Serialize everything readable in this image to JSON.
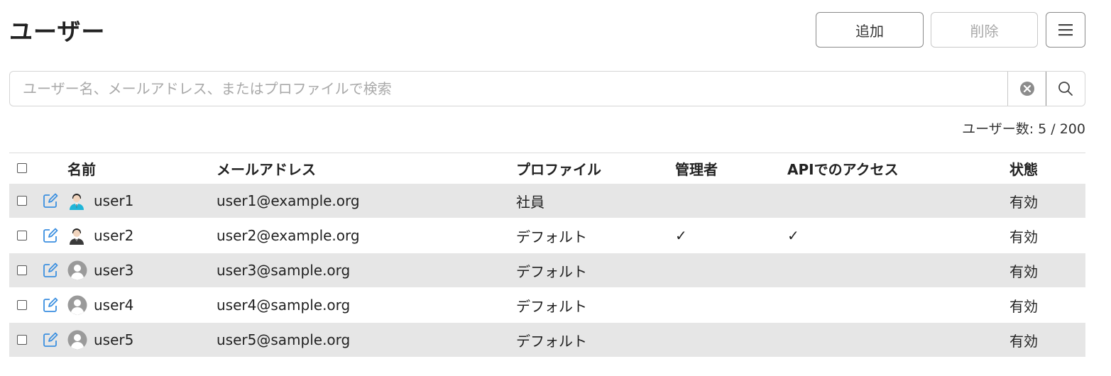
{
  "page": {
    "title": "ユーザー"
  },
  "toolbar": {
    "add_label": "追加",
    "delete_label": "削除",
    "menu_icon": "hamburger-menu-icon"
  },
  "search": {
    "placeholder": "ユーザー名、メールアドレス、またはプロファイルで検索",
    "value": "",
    "clear_icon": "clear-circle-icon",
    "search_icon": "search-icon"
  },
  "user_count": "ユーザー数: 5 / 200",
  "table": {
    "columns": {
      "name": "名前",
      "email": "メールアドレス",
      "profile": "プロファイル",
      "admin": "管理者",
      "api": "APIでのアクセス",
      "status": "状態"
    },
    "rows": [
      {
        "name": "user1",
        "email": "user1@example.org",
        "profile": "社員",
        "admin": "",
        "api": "",
        "status": "有効",
        "avatar": "person-male-icon"
      },
      {
        "name": "user2",
        "email": "user2@example.org",
        "profile": "デフォルト",
        "admin": "✓",
        "api": "✓",
        "status": "有効",
        "avatar": "person-suit-icon"
      },
      {
        "name": "user3",
        "email": "user3@sample.org",
        "profile": "デフォルト",
        "admin": "",
        "api": "",
        "status": "有効",
        "avatar": "default-avatar-icon"
      },
      {
        "name": "user4",
        "email": "user4@sample.org",
        "profile": "デフォルト",
        "admin": "",
        "api": "",
        "status": "有効",
        "avatar": "default-avatar-icon"
      },
      {
        "name": "user5",
        "email": "user5@sample.org",
        "profile": "デフォルト",
        "admin": "",
        "api": "",
        "status": "有効",
        "avatar": "default-avatar-icon"
      }
    ]
  },
  "colors": {
    "row_shade": "#e6e6e6",
    "edit_icon": "#3b8fe0",
    "border": "#8a8a8a"
  }
}
